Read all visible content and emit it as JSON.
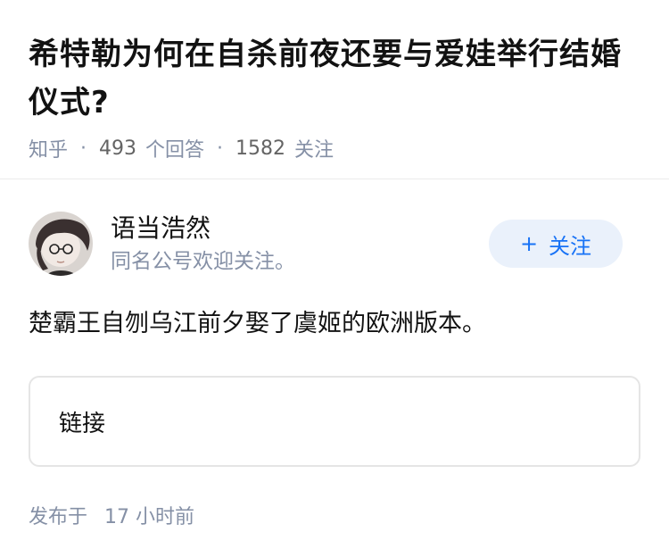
{
  "question": {
    "title_line1": "希特勒为何在自杀前夜还要与爱娃举行结婚",
    "title_line2": "仪式?",
    "source": "知乎",
    "separator": "·",
    "answer_count": "493",
    "answer_label": "个回答",
    "follower_count": "1582",
    "follower_label": "关注"
  },
  "answer": {
    "author": {
      "name": "语当浩然",
      "bio": "同名公号欢迎关注。"
    },
    "follow_button": {
      "plus": "+",
      "label": "关注"
    },
    "content": "楚霸王自刎乌江前夕娶了虞姬的欧洲版本。",
    "link_card_label": "链接",
    "time_prefix": "发布于",
    "time_value": "17",
    "time_unit": "小时前"
  },
  "colors": {
    "accent": "#1772f6",
    "muted": "#8590a6",
    "follow_bg": "#eaf1fb"
  }
}
